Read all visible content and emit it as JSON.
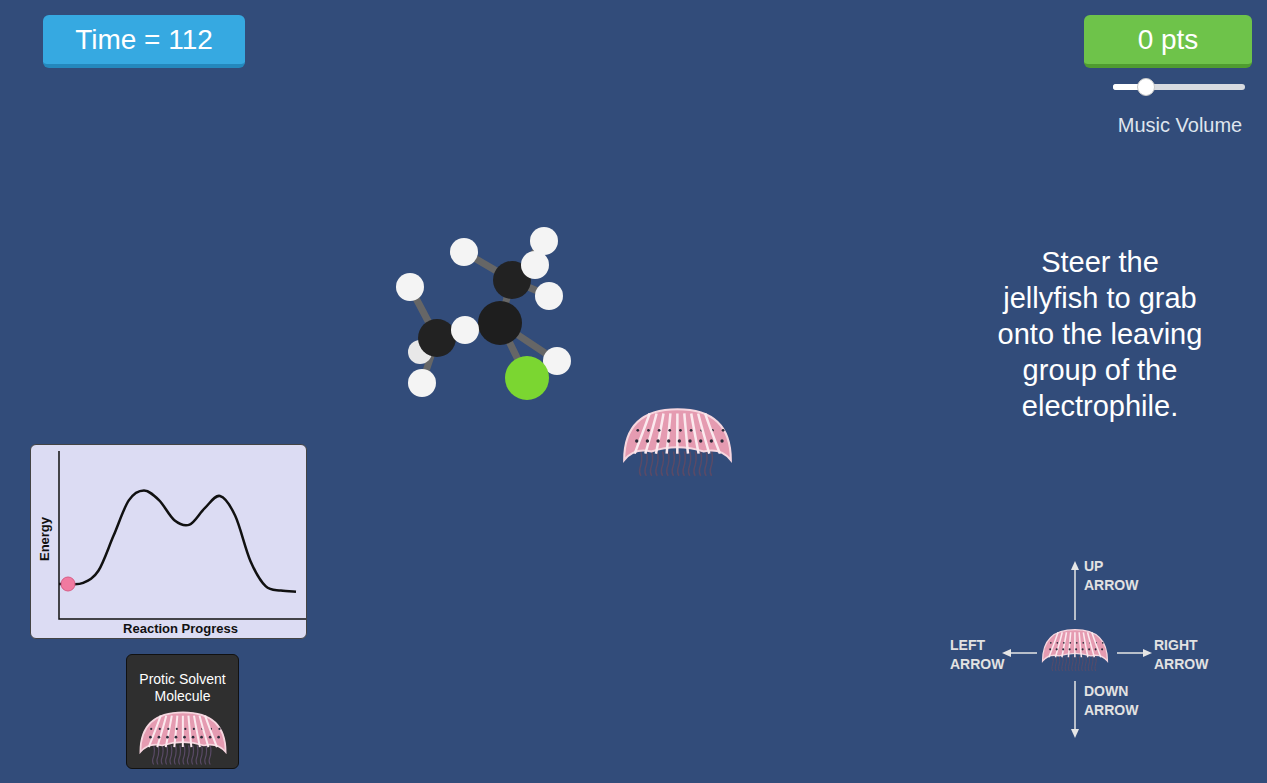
{
  "hud": {
    "time": "Time = 112",
    "score": "0 pts",
    "music_volume": {
      "label": "Music Volume",
      "level": 0.25
    }
  },
  "instruction": [
    "Steer the",
    "jellyfish to grab",
    "onto the leaving",
    "group of the",
    "electrophile."
  ],
  "energy_diagram": {
    "y_label": "Energy",
    "x_label": "Reaction Progress",
    "energy": [
      10,
      11,
      22,
      54,
      86,
      95,
      86,
      68,
      64,
      79,
      90,
      72,
      31,
      8,
      4,
      3
    ],
    "progress": 0
  },
  "solvent_card": {
    "label": "Protic Solvent Molecule"
  },
  "controls": [
    {
      "direction": "up",
      "label": "UP ARROW"
    },
    {
      "direction": "left",
      "label": "LEFT ARROW"
    },
    {
      "direction": "right",
      "label": "RIGHT ARROW"
    },
    {
      "direction": "down",
      "label": "DOWN ARROW"
    }
  ]
}
